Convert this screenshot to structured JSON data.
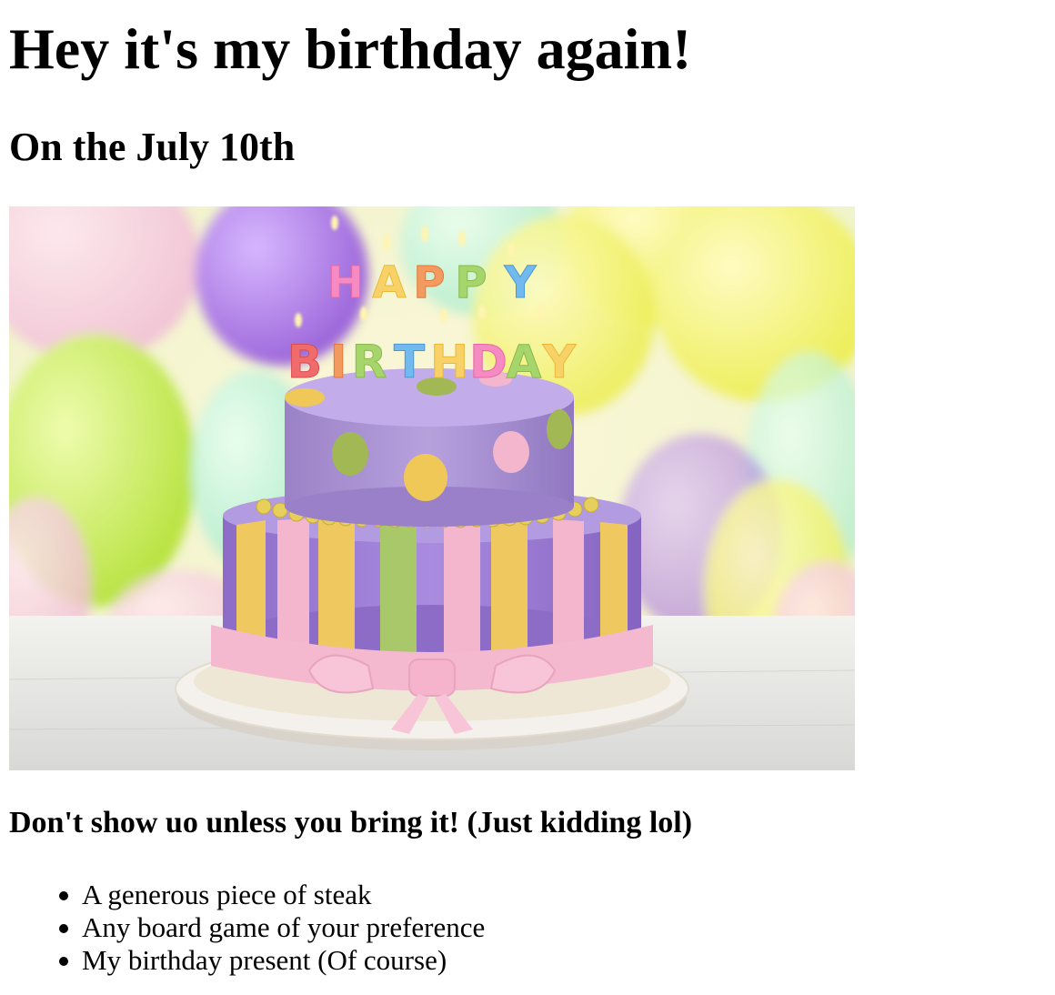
{
  "heading": "Hey it's my birthday again!",
  "date_line": "On the July 10th",
  "photo": {
    "candle_letters_top": "HAPPY",
    "candle_letters_bottom": "BIRTHDAY",
    "colors": {
      "balloon_purple": "#a77be0",
      "balloon_lime": "#c8ec62",
      "balloon_yellow": "#f4f064",
      "cake_purple": "#a98fd2",
      "stripe_yellow": "#f0c860",
      "stripe_green": "#a8c86a",
      "stripe_pink": "#f3b6cc",
      "plate": "#f4f1ec"
    }
  },
  "bring_heading": "Don't show uo unless you bring it! (Just kidding lol)",
  "items": [
    "A generous piece of steak",
    "Any board game of your preference",
    "My birthday present (Of course)"
  ]
}
